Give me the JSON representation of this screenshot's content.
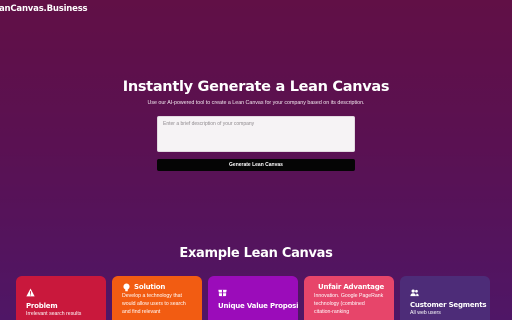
{
  "header": {
    "logo_text": "anCanvas.Business"
  },
  "hero": {
    "title": "Instantly Generate a Lean Canvas",
    "subtitle": "Use our AI-powered tool to create a Lean Canvas for your company based on its description."
  },
  "form": {
    "description_placeholder": "Enter a brief description of your company",
    "description_value": "",
    "generate_label": "Generate Lean Canvas"
  },
  "example": {
    "title": "Example Lean Canvas",
    "cards": [
      {
        "title": "Problem",
        "icon": "warning-icon",
        "color": "#c9183c",
        "text": "Irrelevant search results"
      },
      {
        "title": "Solution",
        "icon": "lightbulb-icon",
        "color": "#f25c12",
        "text": "Develop a technology that would allow users to search and find relevant"
      },
      {
        "title": "Unique Value Proposition",
        "icon": "gift-icon",
        "color": "#9b0cba",
        "text": ""
      },
      {
        "title": "Unfair Advantage",
        "icon": "snowflake-icon",
        "color": "#e7456a",
        "text": "Innovation. Google PageRank technology (combined citation-ranking"
      },
      {
        "title": "Customer Segments",
        "icon": "users-icon",
        "color": "#4d2c78",
        "text": "All web users"
      }
    ]
  }
}
